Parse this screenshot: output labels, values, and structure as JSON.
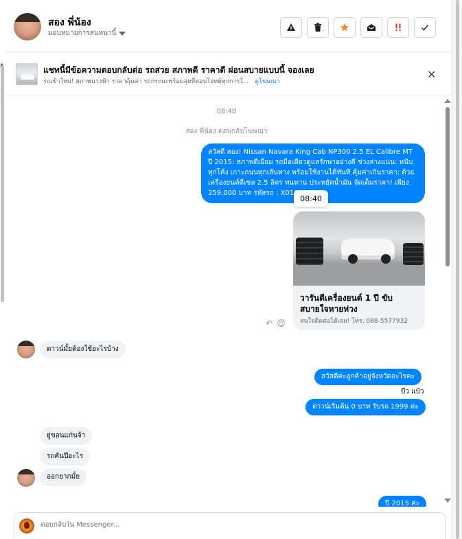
{
  "header": {
    "name": "สอง พี่น้อง",
    "assign_label": "มอบหมายการสนทนานี้",
    "actions": [
      {
        "icon": "warning-icon",
        "label": "!"
      },
      {
        "icon": "trash-icon",
        "label": ""
      },
      {
        "icon": "star-icon",
        "label": "★"
      },
      {
        "icon": "envelope-open-icon",
        "label": ""
      },
      {
        "icon": "important-icon",
        "label": "!!"
      },
      {
        "icon": "check-icon",
        "label": "✓"
      }
    ]
  },
  "ad": {
    "title": "แชทนี้มีข้อความตอบกลับต่อ รถสวย สภาพดี ราคาดี ผ่อนสบายแบบนี้ จองเลย",
    "subtitle": "รถเข้าใหม่! สภาพนางฟ้า ราคาคุ้มค่า รถกระบะพร้อมลุยที่ตอบโจทย์ทุกการใ...",
    "link": "ดูโฆษณา",
    "close": "✕"
  },
  "conversation": {
    "time": "08:40",
    "replied_note": "สอง พี่น้อง ตอบกลับโฆษณา",
    "outgoing_main": "สวัสดี สอง! Nissan Navara King Cab NP300 2.5 EL Calibre MT ปี 2015: สภาพดีเยี่ยม รถมือเดียวดูแลรักษาอย่างดี ช่วงล่างแน่น: หนึบทุกโค้ง เกาะถนนทุกเส้นทาง พร้อมใช้งานได้ทันที คุ้มค่าเกินราคา: ด้วยเครื่องยนต์ดีเซล 2.5 ลิตร ทนทาน ประหยัดน้ำมัน จัดเต็มราคา! เพียง 259,000 บาท รหัสรถ : X010",
    "tooltip_time": "08:40",
    "card_title": "วารันตีเครื่องยนต์ 1 ปี ขับสบายใจหายห่วง",
    "card_subtitle": "สนใจติดต่อได้เลย!  โทร: 088-5577932",
    "msgs": {
      "in1": "ดาวน์มั้ยต้องใช้อะไรบ้าง",
      "out1": "สวัสดีค่ะลูกค้าอยู่จังหวัดอะไรคะ",
      "sender_label": "บีว แบ้ว",
      "out2": "ดาวน์เริ่มต้น 0 บาท รับรถ 1999 ค่ะ",
      "in2": "ยู่ขอนแก่นจ้า",
      "in3": "รถคันปีอะไร",
      "in4": "ออกยากมั้ย",
      "out3": "ปี 2015 ค่ะ"
    }
  },
  "composer": {
    "placeholder": "ตอบกลับใน Messenger..."
  }
}
